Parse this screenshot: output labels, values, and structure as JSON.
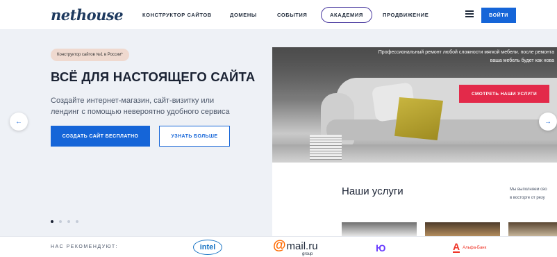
{
  "header": {
    "logo": "nethouse",
    "nav": [
      {
        "label": "КОНСТРУКТОР САЙТОВ"
      },
      {
        "label": "ДОМЕНЫ"
      },
      {
        "label": "СОБЫТИЯ"
      },
      {
        "label": "АКАДЕМИЯ"
      },
      {
        "label": "ПРОДВИЖЕНИЕ"
      }
    ],
    "menu_icon": "hamburger-icon",
    "login_label": "ВОЙТИ"
  },
  "hero": {
    "badge": "Конструктор сайтов №1 в России*",
    "title": "ВСЁ ДЛЯ НАСТОЯЩЕГО САЙТА",
    "subtitle": "Создайте интернет-магазин, сайт-визитку или лендинг с помощью невероятно удобного сервиса",
    "primary_button": "СОЗДАТЬ САЙТ БЕСПЛАТНО",
    "secondary_button": "УЗНАТЬ БОЛЬШЕ",
    "prev_icon": "arrow-left-icon",
    "next_icon": "arrow-right-icon",
    "slides_total": 4,
    "active_slide": 1
  },
  "preview": {
    "banner_text": "Профессиональный ремонт любой сложности мягкой мебели. после ремонта ваша мебель будет как нова",
    "banner_button": "СМОТРЕТЬ НАШИ УСЛУГИ",
    "services_title": "Наши услуги",
    "services_desc_1": "Мы выполняем сво",
    "services_desc_2": "в восторге от резу"
  },
  "partners": {
    "label": "НАС РЕКОМЕНДУЮТ:",
    "intel": "intel",
    "mail_at": "@",
    "mail_brand": "mail.ru",
    "mail_group": "group",
    "yo": "Ю",
    "alfa_letter": "А",
    "alfa_name": "Альфа-Банк"
  },
  "colors": {
    "accent_blue": "#1565d8",
    "accent_red": "#e32a4a",
    "hero_bg": "#eef1f6",
    "badge_bg": "#efd9cf"
  }
}
